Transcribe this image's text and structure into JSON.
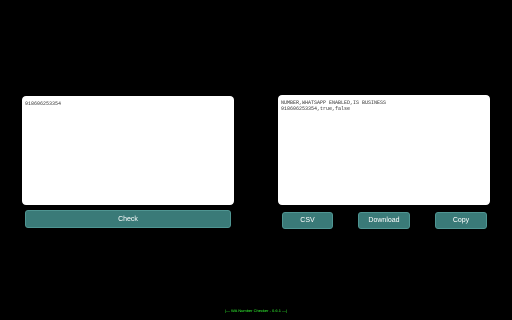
{
  "input": {
    "value": "918606253354"
  },
  "output": {
    "value": "NUMBER,WHATSAPP ENABLED,IS BUSINESS\n918606253354,true,false"
  },
  "buttons": {
    "check": "Check",
    "csv": "CSV",
    "download": "Download",
    "copy": "Copy"
  },
  "footer": {
    "text": "|— WA Number Checker - 0.6.1 —|"
  },
  "colors": {
    "background": "#000000",
    "button": "#3a7a78",
    "footer_text": "#33ff33"
  }
}
